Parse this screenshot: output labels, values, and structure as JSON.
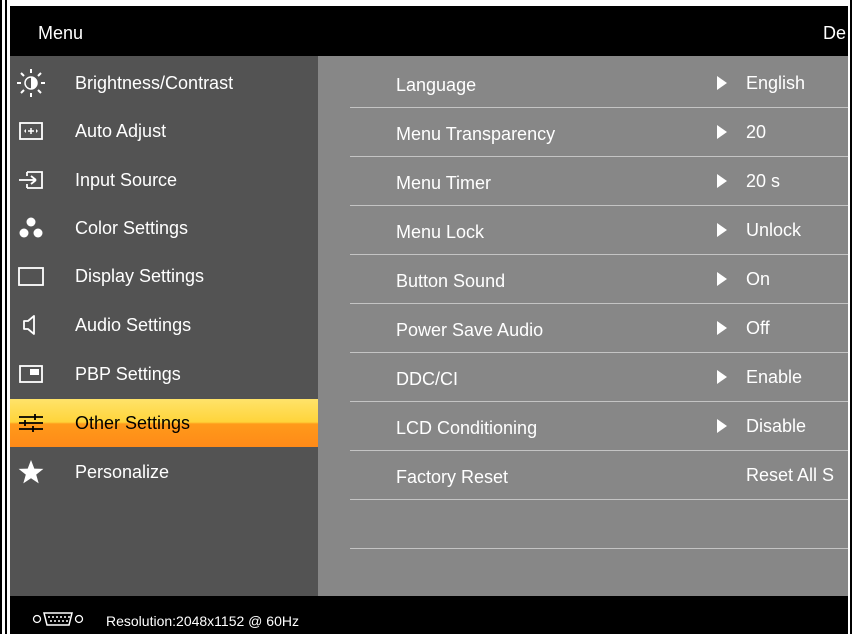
{
  "header": {
    "title": "Menu",
    "model": "De"
  },
  "left_menu": [
    {
      "label": "Brightness/Contrast",
      "icon": "sun-icon"
    },
    {
      "label": "Auto Adjust",
      "icon": "auto-adjust-icon"
    },
    {
      "label": "Input Source",
      "icon": "input-source-icon"
    },
    {
      "label": "Color Settings",
      "icon": "color-dots-icon"
    },
    {
      "label": "Display Settings",
      "icon": "display-rect-icon"
    },
    {
      "label": "Audio Settings",
      "icon": "speaker-icon"
    },
    {
      "label": "PBP Settings",
      "icon": "pbp-icon"
    },
    {
      "label": "Other Settings",
      "icon": "sliders-icon",
      "active": true
    },
    {
      "label": "Personalize",
      "icon": "star-icon"
    }
  ],
  "settings": [
    {
      "label": "Language",
      "value": "English"
    },
    {
      "label": "Menu Transparency",
      "value": "20"
    },
    {
      "label": "Menu Timer",
      "value": "20 s"
    },
    {
      "label": "Menu Lock",
      "value": "Unlock"
    },
    {
      "label": "Button Sound",
      "value": "On"
    },
    {
      "label": "Power Save Audio",
      "value": "Off"
    },
    {
      "label": "DDC/CI",
      "value": "Enable"
    },
    {
      "label": "LCD Conditioning",
      "value": "Disable"
    },
    {
      "label": "Factory Reset",
      "value": "Reset All S"
    }
  ],
  "footer": {
    "resolution": "Resolution:2048x1152 @ 60Hz",
    "connector_icon": "vga-connector-icon"
  },
  "colors": {
    "active_top": "#ffd43a",
    "active_bottom": "#ff8a18",
    "left_bg": "#535353",
    "right_bg": "#878787"
  }
}
